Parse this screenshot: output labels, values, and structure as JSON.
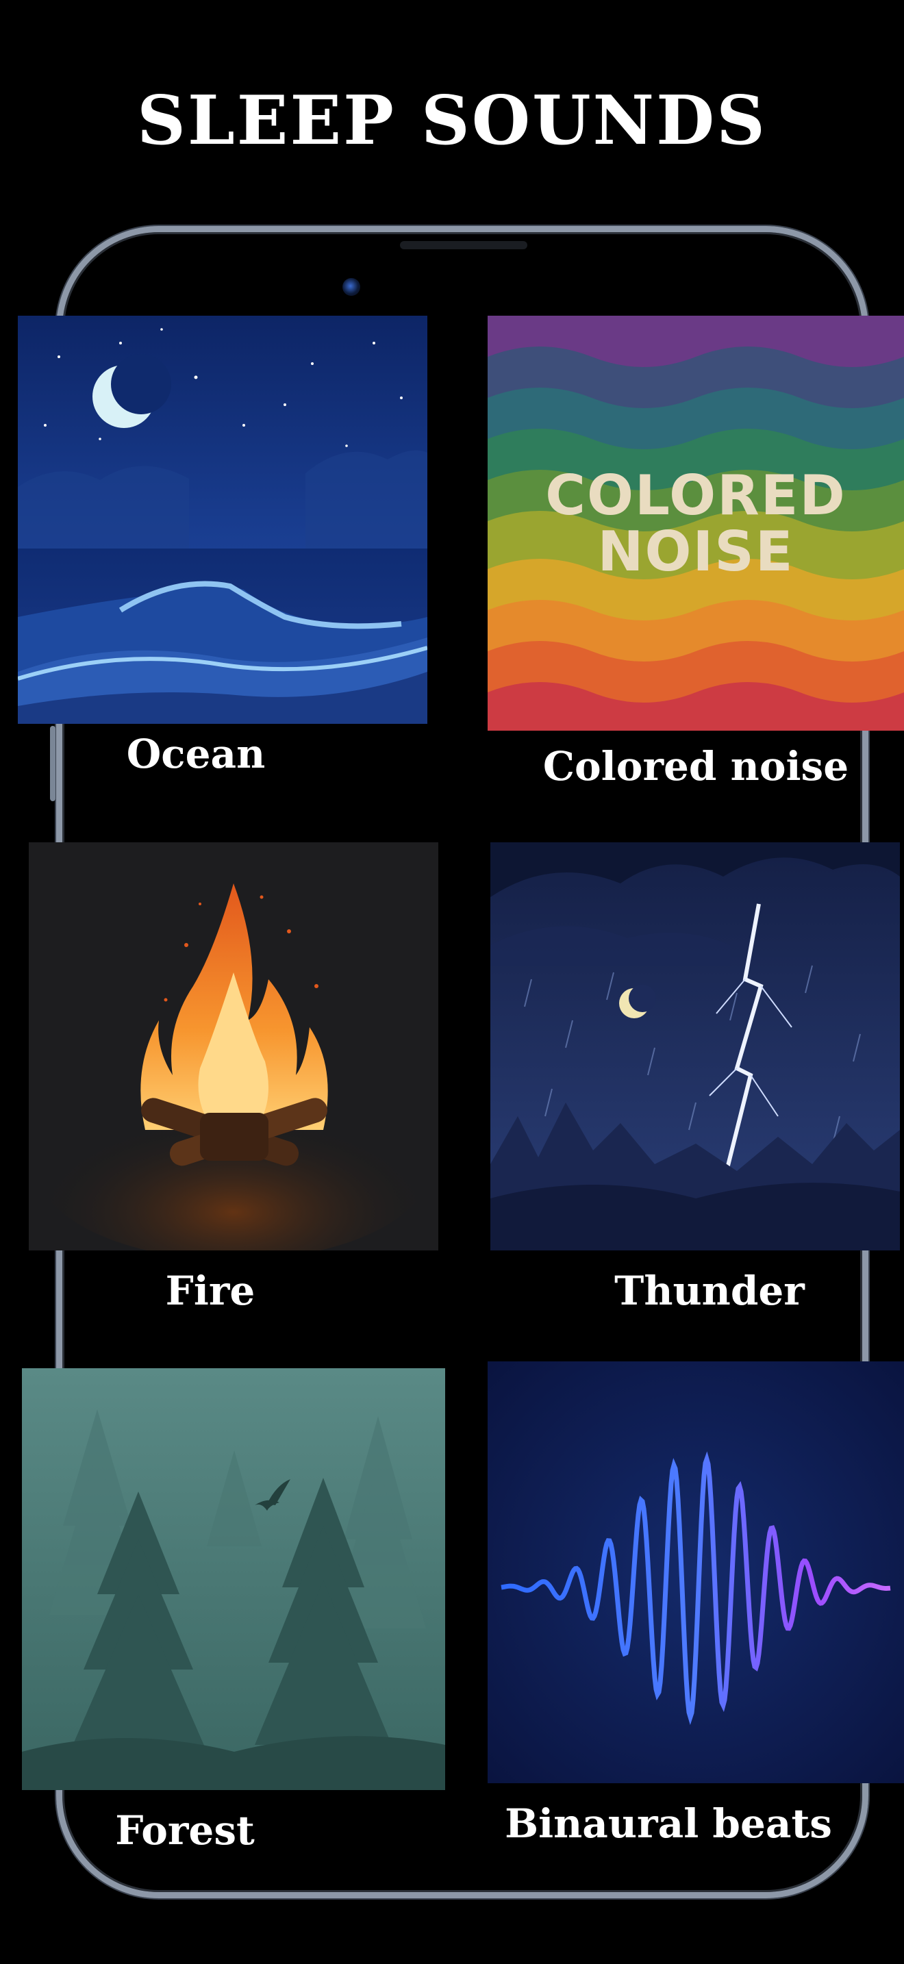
{
  "title": "SLEEP SOUNDS",
  "sounds": [
    {
      "label": "Ocean",
      "icon": "ocean-moon-icon"
    },
    {
      "label": "Colored noise",
      "icon": "rainbow-waves-icon",
      "art_line1": "COLORED",
      "art_line2": "NOISE"
    },
    {
      "label": "Fire",
      "icon": "campfire-icon"
    },
    {
      "label": "Thunder",
      "icon": "lightning-storm-icon"
    },
    {
      "label": "Forest",
      "icon": "misty-forest-icon"
    },
    {
      "label": "Binaural beats",
      "icon": "sound-wave-icon"
    }
  ],
  "colors": {
    "background": "#000000",
    "phone_frame": "#8d98a8",
    "text": "#ffffff"
  }
}
